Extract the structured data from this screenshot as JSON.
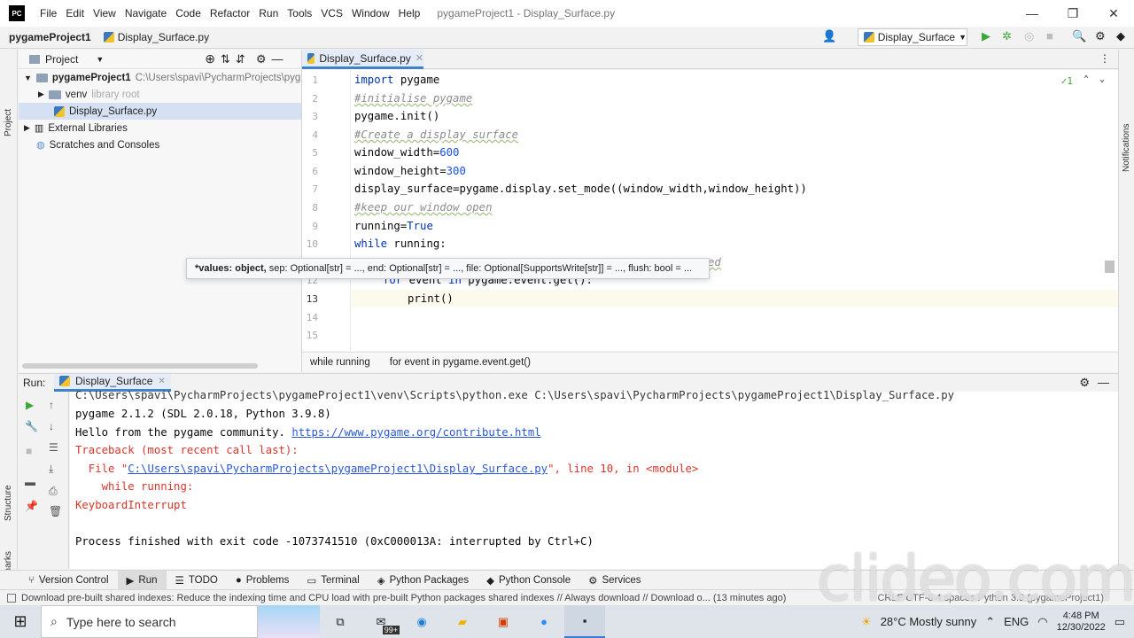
{
  "titlebar": {
    "logo": "PC",
    "menu": [
      "File",
      "Edit",
      "View",
      "Navigate",
      "Code",
      "Refactor",
      "Run",
      "Tools",
      "VCS",
      "Window",
      "Help"
    ],
    "title": "pygameProject1 - Display_Surface.py",
    "controls": [
      "—",
      "❐",
      "✕"
    ]
  },
  "navbar": {
    "project": "pygameProject1",
    "file": "Display_Surface.py",
    "run_config": "Display_Surface"
  },
  "left_stripe": {
    "project_label": "Project",
    "structure_label": "Structure",
    "bookmarks_label": "Bookmarks"
  },
  "right_stripe": {
    "notifications_label": "Notifications"
  },
  "project_panel": {
    "header": "Project",
    "tree": {
      "root_name": "pygameProject1",
      "root_path": "C:\\Users\\spavi\\PycharmProjects\\pygam",
      "venv": "venv",
      "venv_hint": "library root",
      "file": "Display_Surface.py",
      "external": "External Libraries",
      "scratches": "Scratches and Consoles"
    }
  },
  "editor": {
    "tab": "Display_Surface.py",
    "inspection_count": "1",
    "lines": {
      "l1a": "import",
      "l1b": " pygame",
      "l2": "#initialise pygame",
      "l3": "pygame.init()",
      "l4": "#Create a display surface",
      "l5a": "window_width=",
      "l5b": "600",
      "l6a": "window_height=",
      "l6b": "300",
      "l7": "display_surface=pygame.display.set_mode((window_width,window_height))",
      "l8": "#keep our window open",
      "l9a": "running=",
      "l9b": "True",
      "l10a": "while",
      "l10b": " running:",
      "l11tail": "ed",
      "l12a": "for",
      "l12b": " event ",
      "l12c": "in",
      "l12d": " pygame.event.get():",
      "l13": "print()"
    },
    "line_numbers": [
      "1",
      "2",
      "3",
      "4",
      "5",
      "6",
      "7",
      "8",
      "9",
      "10",
      "12",
      "13",
      "14",
      "15"
    ],
    "hint": {
      "bold": "*values: object,",
      "rest": " sep: Optional[str] = ..., end: Optional[str] = ..., file: Optional[SupportsWrite[str]] = ..., flush: bool = ..."
    },
    "breadcrumbs": [
      "while running",
      "for event in pygame.event.get()"
    ]
  },
  "run_panel": {
    "label": "Run:",
    "tab": "Display_Surface",
    "console": {
      "cmd": "C:\\Users\\spavi\\PycharmProjects\\pygameProject1\\venv\\Scripts\\python.exe C:\\Users\\spavi\\PycharmProjects\\pygameProject1\\Display_Surface.py",
      "version": "pygame 2.1.2 (SDL 2.0.18, Python 3.9.8)",
      "hello": "Hello from the pygame community. ",
      "hello_link": "https://www.pygame.org/contribute.html",
      "traceback": "Traceback (most recent call last):",
      "file_prefix": "  File \"",
      "file_link": "C:\\Users\\spavi\\PycharmProjects\\pygameProject1\\Display_Surface.py",
      "file_suffix": "\", line 10, in <module>",
      "while": "    while running:",
      "kbi": "KeyboardInterrupt",
      "finished": "Process finished with exit code -1073741510 (0xC000013A: interrupted by Ctrl+C)"
    }
  },
  "tooltabs": [
    "Version Control",
    "Run",
    "TODO",
    "Problems",
    "Terminal",
    "Python Packages",
    "Python Console",
    "Services"
  ],
  "statusbar": {
    "message": "Download pre-built shared indexes: Reduce the indexing time and CPU load with pre-built Python packages shared indexes // Always download // Download o... (13 minutes ago)",
    "right": "CRLF   UTF-8   4 spaces   Python 3.9 (pygameProject1)"
  },
  "taskbar": {
    "search_placeholder": "Type here to search",
    "badge": "99+",
    "weather": "28°C  Mostly sunny",
    "lang": "ENG",
    "time": "4:48 PM",
    "date": "12/30/2022"
  },
  "watermark": "clideo.com",
  "colors": {
    "accent": "#4083c9",
    "error": "#d9342b",
    "keyword": "#0033b3",
    "number": "#1750eb",
    "comment": "#8c8c8c"
  }
}
